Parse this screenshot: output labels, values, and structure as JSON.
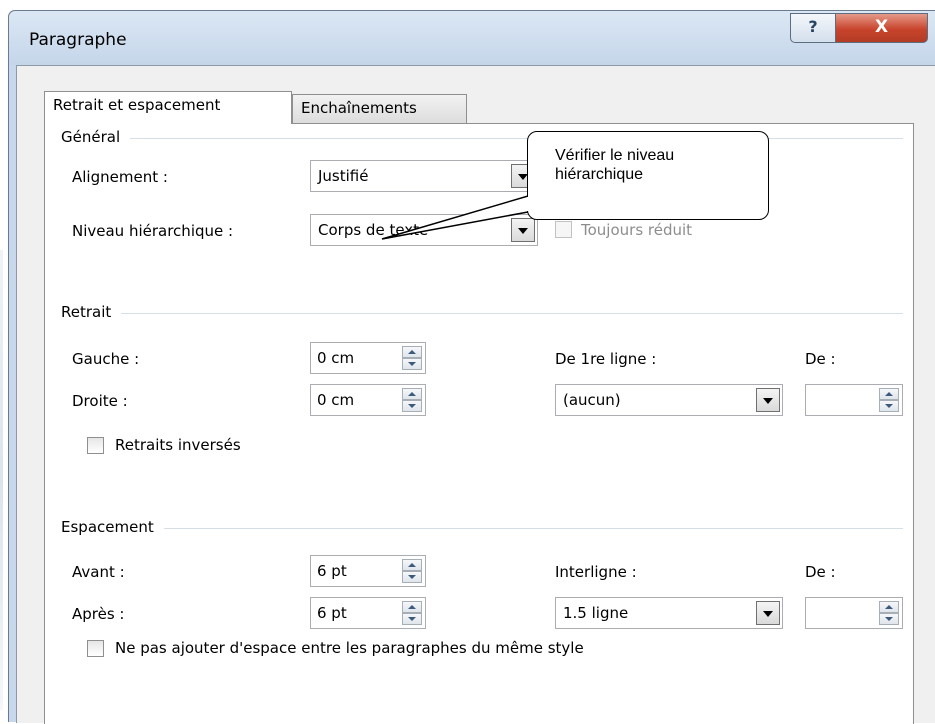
{
  "window": {
    "title": "Paragraphe",
    "help_label": "?",
    "close_label": "X"
  },
  "tabs": [
    {
      "label": "Retrait et espacement",
      "active": true
    },
    {
      "label": "Enchaînements",
      "active": false
    }
  ],
  "general": {
    "group_label": "Général",
    "alignment_label": "Alignement :",
    "alignment_value": "Justifié",
    "level_label": "Niveau hiérarchique :",
    "level_value": "Corps de texte",
    "collapsed_label": "Toujours réduit",
    "collapsed_checked": false,
    "collapsed_enabled": false
  },
  "indent": {
    "group_label": "Retrait",
    "left_label": "Gauche :",
    "left_value": "0 cm",
    "right_label": "Droite :",
    "right_value": "0 cm",
    "first_line_label": "De 1re ligne :",
    "first_line_value": "(aucun)",
    "by_label": "De :",
    "by_value": "",
    "mirror_label": "Retraits inversés",
    "mirror_checked": false
  },
  "spacing": {
    "group_label": "Espacement",
    "before_label": "Avant :",
    "before_value": "6 pt",
    "after_label": "Après :",
    "after_value": "6 pt",
    "line_label": "Interligne :",
    "line_value": "1.5 ligne",
    "at_label": "De :",
    "at_value": "",
    "no_space_label": "Ne pas ajouter d'espace entre les paragraphes du même style",
    "no_space_checked": false
  },
  "callout": {
    "text": "Vérifier le niveau hiérarchique"
  },
  "colors": {
    "title_bar": "#c5d6ea",
    "close_button": "#c8442c",
    "dialog_bg": "#f0f0f0"
  }
}
